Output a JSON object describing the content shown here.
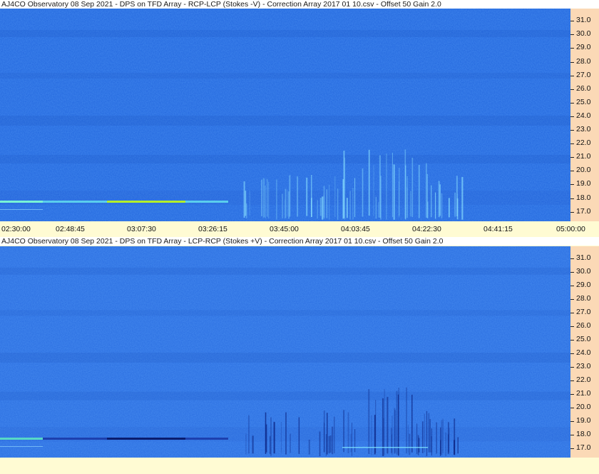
{
  "chart_data": [
    {
      "type": "heatmap",
      "title": "AJ4CO Observatory 08 Sep 2021  -  DPS on TFD Array  -  RCP-LCP (Stokes -V)  -  Correction Array 2017 01 10.csv  -  Offset 50  Gain 2.0",
      "y_ticks": [
        "31.0",
        "30.0",
        "29.0",
        "28.0",
        "27.0",
        "26.0",
        "25.0",
        "24.0",
        "23.0",
        "22.0",
        "21.0",
        "20.0",
        "19.0",
        "18.0",
        "17.0"
      ],
      "ylim": [
        16.3,
        31.9
      ],
      "x_ticks": [
        "02:30:00",
        "02:48:45",
        "03:07:30",
        "03:26:15",
        "03:45:00",
        "04:03:45",
        "04:22:30",
        "04:41:15",
        "05:00:00"
      ],
      "colors": {
        "background": "#2266dd",
        "emission": "#7ee0ff",
        "hot": "#b8f020"
      }
    },
    {
      "type": "heatmap",
      "title": "AJ4CO Observatory 08 Sep 2021  -  DPS on TFD Array  -  LCP-RCP (Stokes +V)  -  Correction Array 2017 01 10.csv  -  Offset 50  Gain 2.0",
      "y_ticks": [
        "31.0",
        "30.0",
        "29.0",
        "28.0",
        "27.0",
        "26.0",
        "25.0",
        "24.0",
        "23.0",
        "22.0",
        "21.0",
        "20.0",
        "19.0",
        "18.0",
        "17.0"
      ],
      "ylim": [
        16.3,
        31.9
      ],
      "colors": {
        "background": "#2a6de0",
        "absorption": "#0a1a6a",
        "hot": "#66ffcc"
      }
    }
  ]
}
